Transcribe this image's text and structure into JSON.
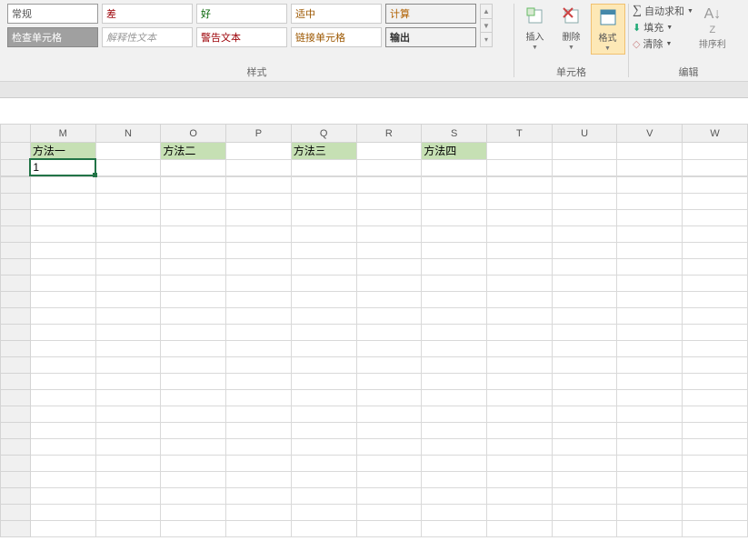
{
  "ribbon": {
    "styles": {
      "normal": "常规",
      "check": "检查单元格",
      "bad": "差",
      "explain": "解释性文本",
      "good": "好",
      "warn": "警告文本",
      "neutral": "适中",
      "link": "链接单元格",
      "calc": "计算",
      "output": "输出",
      "group_label": "样式"
    },
    "cells": {
      "insert": "插入",
      "delete": "删除",
      "format": "格式",
      "group_label": "单元格"
    },
    "edit": {
      "autosum": "自动求和",
      "fill": "填充",
      "clear": "清除",
      "sort": "排序利",
      "group_label": "编辑"
    }
  },
  "columns": [
    "M",
    "N",
    "O",
    "P",
    "Q",
    "R",
    "S",
    "T",
    "U",
    "V",
    "W"
  ],
  "headers": {
    "m": "方法一",
    "o": "方法二",
    "q": "方法三",
    "s": "方法四"
  },
  "active_cell_value": "1"
}
